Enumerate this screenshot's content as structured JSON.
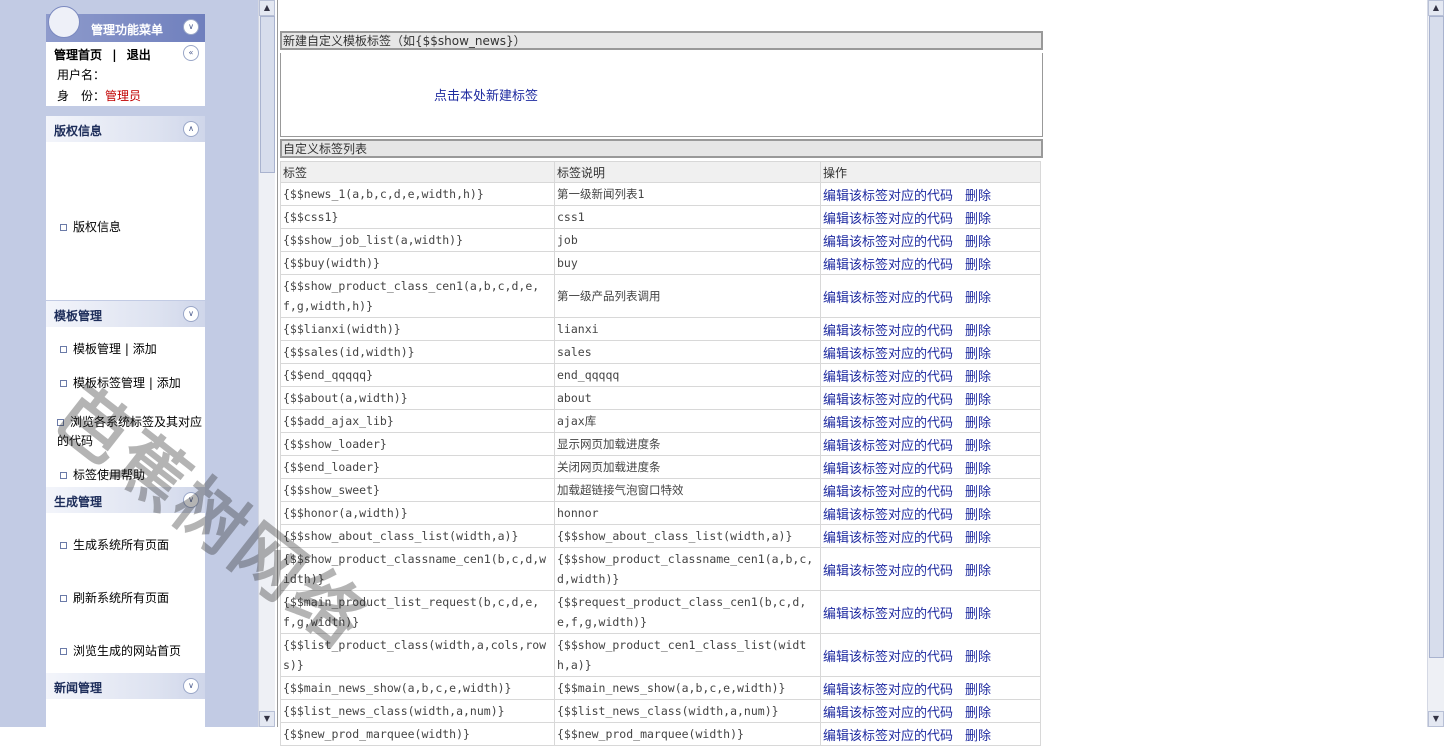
{
  "sidebar": {
    "menu_title": "管理功能菜单",
    "home_link": "管理首页",
    "sep": "|",
    "logout_link": "退出",
    "username_label": "用户名：",
    "identity_label": "身　份：",
    "identity_value": "管理员",
    "sections": [
      {
        "title": "版权信息",
        "items": [
          "版权信息"
        ]
      },
      {
        "title": "模板管理",
        "items": [
          "模板管理",
          "模板标签管理",
          "浏览各系统标签及其对应的代码",
          "标签使用帮助"
        ]
      },
      {
        "title": "生成管理",
        "items": [
          "生成系统所有页面",
          "刷新系统所有页面",
          "浏览生成的网站首页"
        ]
      },
      {
        "title": "新闻管理",
        "items": []
      }
    ],
    "add_link": "添加"
  },
  "main": {
    "new_section_title": "新建自定义模板标签（如{$$show_news}）",
    "new_link": "点击本处新建标签",
    "list_title": "自定义标签列表",
    "columns": [
      "标签",
      "标签说明",
      "操作"
    ],
    "edit_label": "编辑该标签对应的代码",
    "delete_label": "删除",
    "rows": [
      [
        "{$$news_1(a,b,c,d,e,width,h)}",
        "第一级新闻列表1"
      ],
      [
        "{$$css1}",
        "css1"
      ],
      [
        "{$$show_job_list(a,width)}",
        "job"
      ],
      [
        "{$$buy(width)}",
        "buy"
      ],
      [
        "{$$show_product_class_cen1(a,b,c,d,e,f,g,width,h)}",
        "第一级产品列表调用"
      ],
      [
        "{$$lianxi(width)}",
        "lianxi"
      ],
      [
        "{$$sales(id,width)}",
        "sales"
      ],
      [
        "{$$end_qqqqq}",
        "end_qqqqq"
      ],
      [
        "{$$about(a,width)}",
        "about"
      ],
      [
        "{$$add_ajax_lib}",
        "ajax库"
      ],
      [
        "{$$show_loader}",
        "显示网页加载进度条"
      ],
      [
        "{$$end_loader}",
        "关闭网页加载进度条"
      ],
      [
        "{$$show_sweet}",
        "加载超链接气泡窗口特效"
      ],
      [
        "{$$honor(a,width)}",
        "honnor"
      ],
      [
        "{$$show_about_class_list(width,a)}",
        "{$$show_about_class_list(width,a)}"
      ],
      [
        "{$$show_product_classname_cen1(b,c,d,width)}",
        "{$$show_product_classname_cen1(a,b,c,d,width)}"
      ],
      [
        "{$$main_product_list_request(b,c,d,e,f,g,width)}",
        "{$$request_product_class_cen1(b,c,d,e,f,g,width)}"
      ],
      [
        "{$$list_product_class(width,a,cols,rows)}",
        "{$$show_product_cen1_class_list(width,a)}"
      ],
      [
        "{$$main_news_show(a,b,c,e,width)}",
        "{$$main_news_show(a,b,c,e,width)}"
      ],
      [
        "{$$list_news_class(width,a,num)}",
        "{$$list_news_class(width,a,num)}"
      ],
      [
        "{$$new_prod_marquee(width)}",
        "{$$new_prod_marquee(width)}"
      ]
    ]
  },
  "watermark": "芭蕉树网络"
}
